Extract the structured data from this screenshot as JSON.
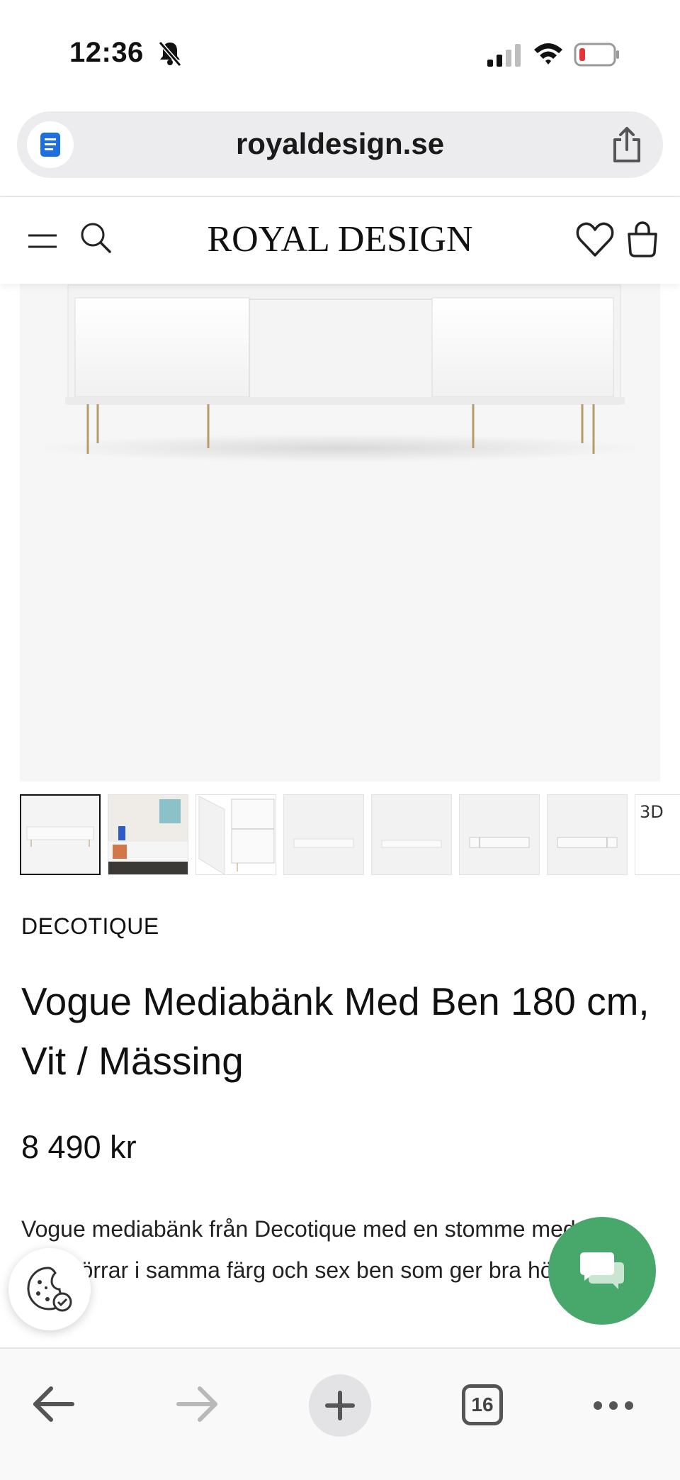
{
  "status_bar": {
    "time": "12:36"
  },
  "browser": {
    "url": "royaldesign.se",
    "open_tabs_count": "16"
  },
  "site": {
    "logo_text": "ROYAL DESIGN"
  },
  "product": {
    "brand": "DECOTIQUE",
    "title": "Vogue Mediabänk Med Ben 180 cm, Vit / Mässing",
    "price": "8 490 kr",
    "description": "Vogue mediabänk från Decotique med en stomme med tre skjutdörrar i samma färg och sex ben som ger bra höjd.",
    "thumbnail_3d_label": "3D"
  },
  "colors": {
    "chat_button": "#48a86c",
    "image_background": "#f6f6f6",
    "url_bar_background": "#ececef",
    "reader_icon": "#1e6fe0",
    "battery_low": "#e5333a"
  },
  "icons": [
    "bell-slash-icon",
    "signal-icon",
    "wifi-icon",
    "battery-icon",
    "reader-mode-icon",
    "share-icon",
    "menu-icon",
    "search-icon",
    "heart-icon",
    "bag-icon",
    "cookie-icon",
    "chat-icon",
    "back-arrow-icon",
    "forward-arrow-icon",
    "plus-icon",
    "more-icon"
  ]
}
